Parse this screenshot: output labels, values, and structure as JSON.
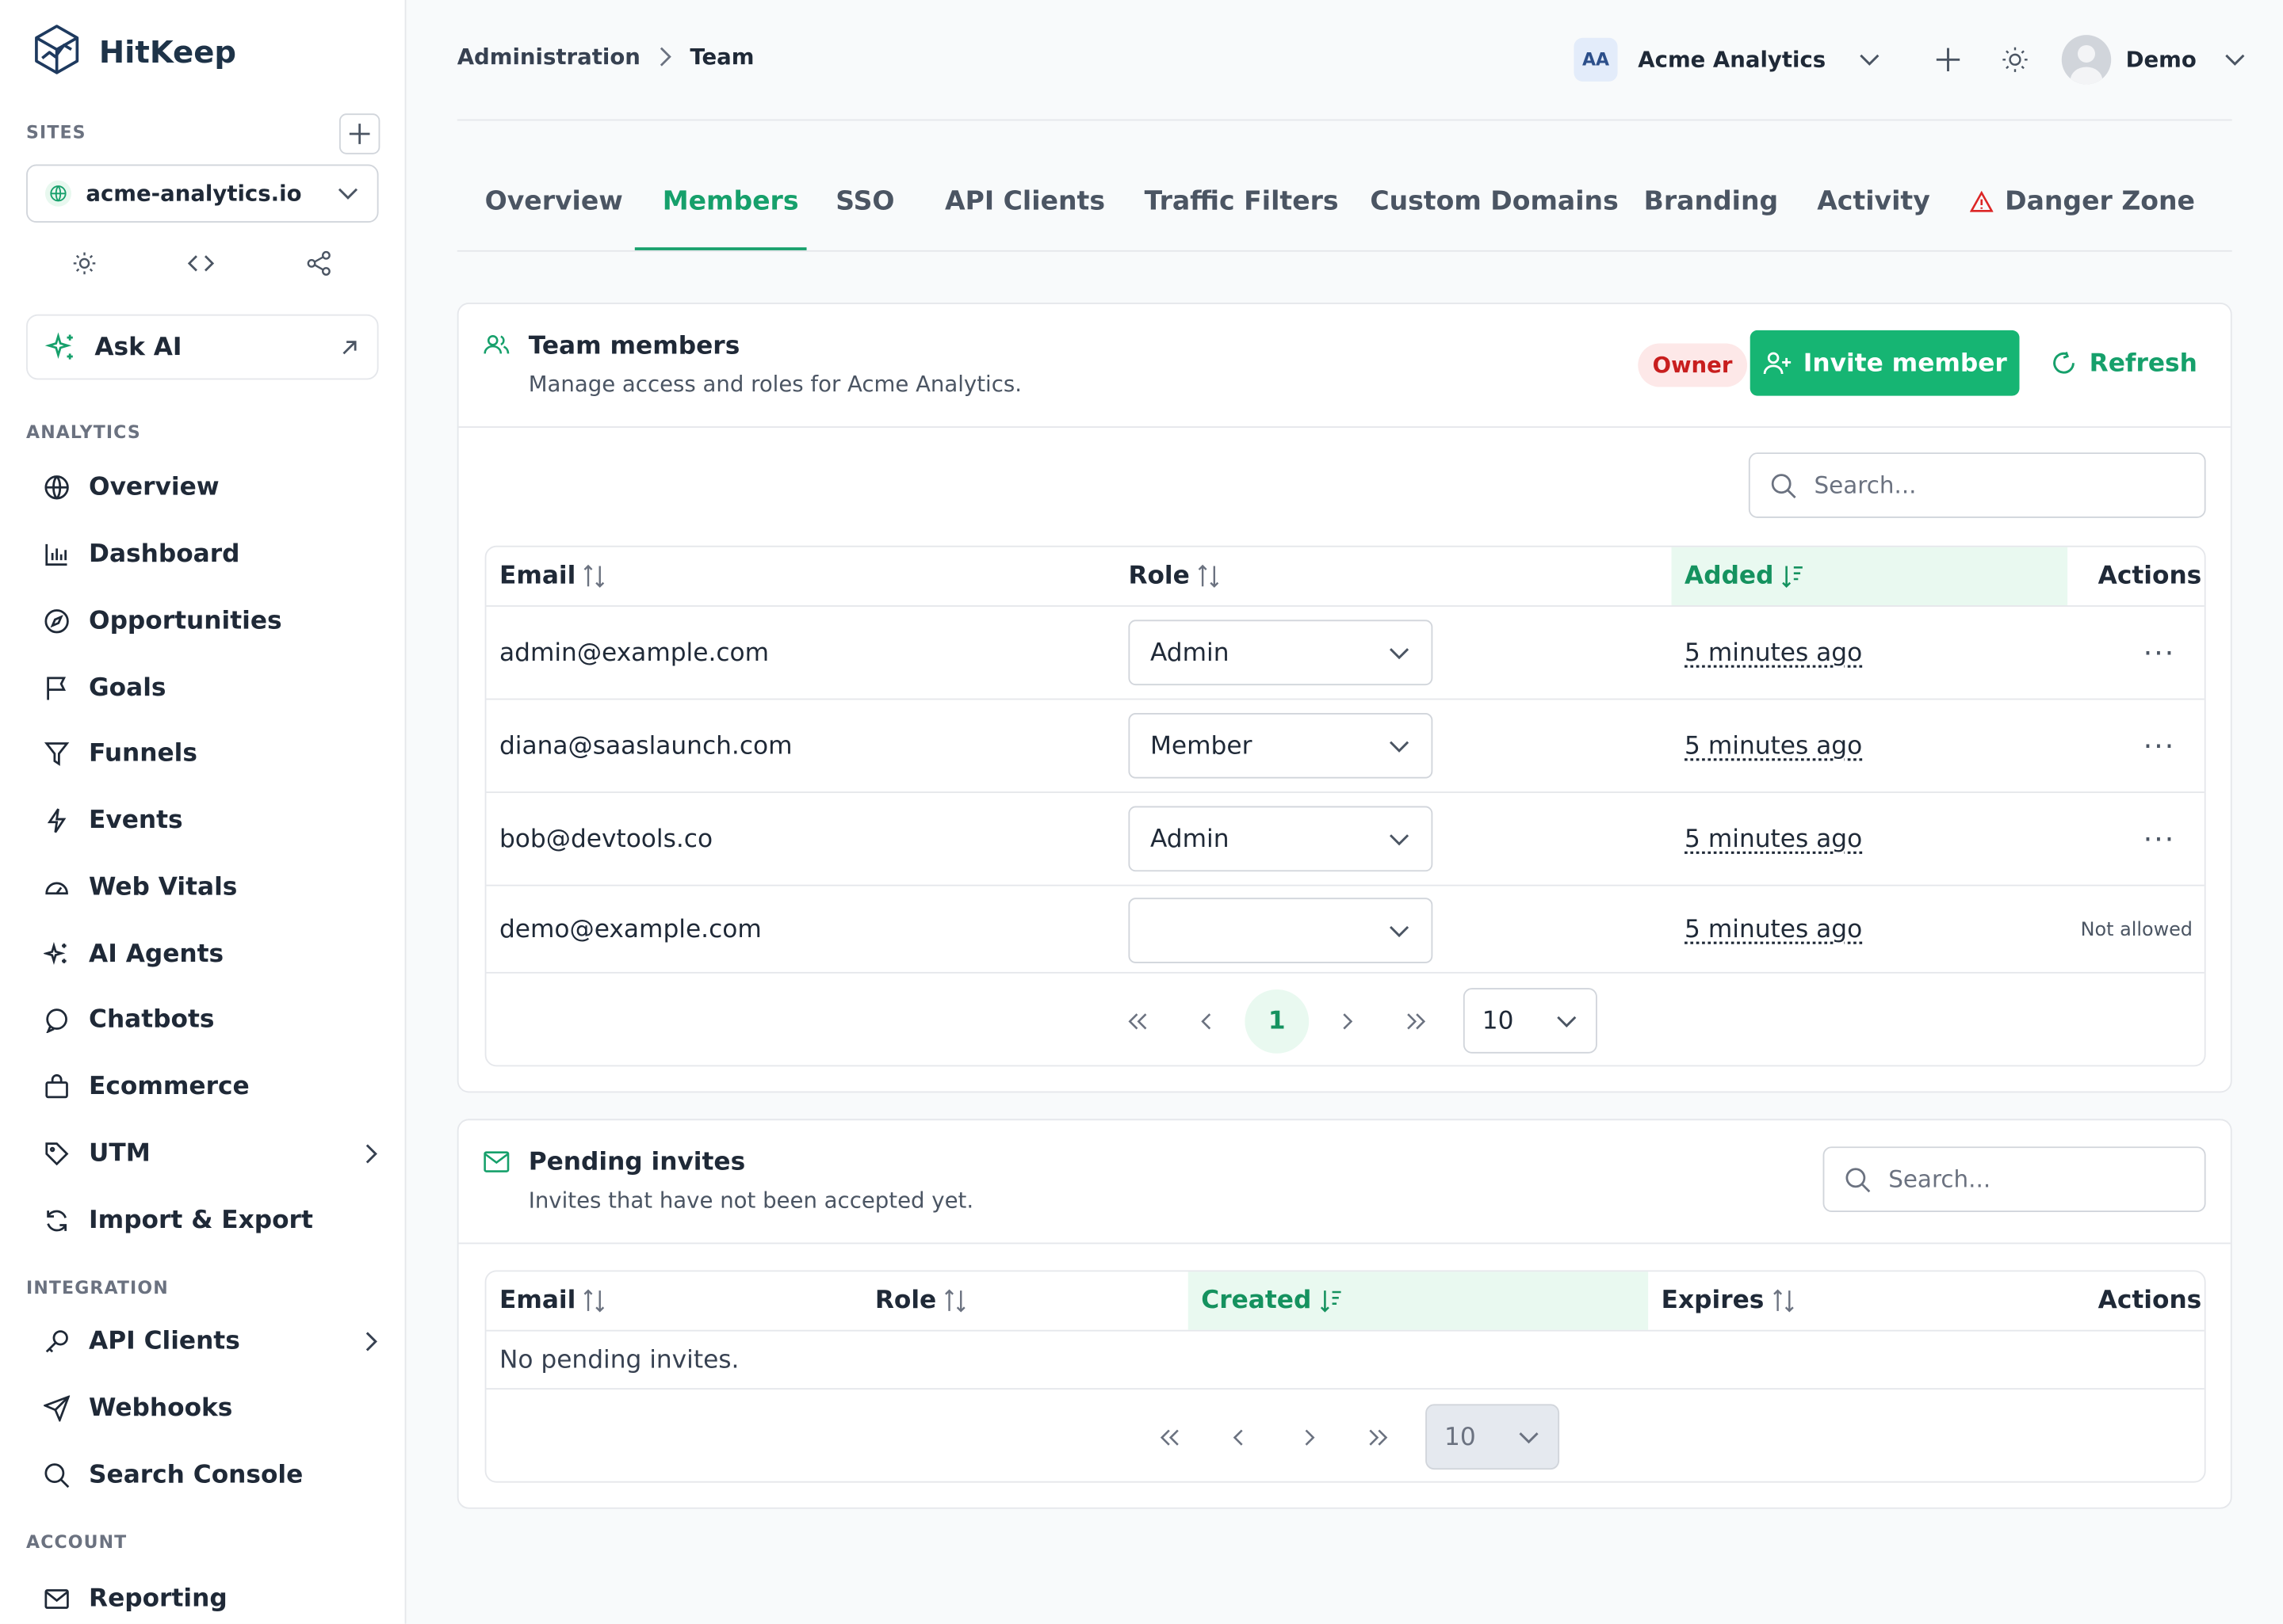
{
  "app": {
    "name": "HitKeep"
  },
  "sidebar": {
    "sites_label": "SITES",
    "site": "acme-analytics.io",
    "ask_ai": "Ask AI",
    "analytics_label": "ANALYTICS",
    "analytics": [
      {
        "label": "Overview",
        "icon": "globe-icon"
      },
      {
        "label": "Dashboard",
        "icon": "bar-chart-icon"
      },
      {
        "label": "Opportunities",
        "icon": "compass-icon"
      },
      {
        "label": "Goals",
        "icon": "flag-icon"
      },
      {
        "label": "Funnels",
        "icon": "funnel-icon"
      },
      {
        "label": "Events",
        "icon": "bolt-icon"
      },
      {
        "label": "Web Vitals",
        "icon": "gauge-icon"
      },
      {
        "label": "AI Agents",
        "icon": "sparkles-icon"
      },
      {
        "label": "Chatbots",
        "icon": "chat-icon"
      },
      {
        "label": "Ecommerce",
        "icon": "shopping-bag-icon"
      },
      {
        "label": "UTM",
        "icon": "tag-icon"
      },
      {
        "label": "Import & Export",
        "icon": "sync-icon"
      }
    ],
    "integration_label": "INTEGRATION",
    "integration": [
      {
        "label": "API Clients",
        "icon": "key-icon"
      },
      {
        "label": "Webhooks",
        "icon": "send-icon"
      },
      {
        "label": "Search Console",
        "icon": "search-icon"
      }
    ],
    "account_label": "ACCOUNT",
    "account": [
      {
        "label": "Reporting",
        "icon": "mail-icon"
      }
    ]
  },
  "header": {
    "breadcrumb": [
      "Administration",
      "Team"
    ],
    "org_initials": "AA",
    "org_name": "Acme Analytics",
    "user_name": "Demo"
  },
  "tabs": [
    "Overview",
    "Members",
    "SSO",
    "API Clients",
    "Traffic Filters",
    "Custom Domains",
    "Branding",
    "Activity",
    "Danger Zone"
  ],
  "active_tab": "Members",
  "members": {
    "title": "Team members",
    "subtitle": "Manage access and roles for Acme Analytics.",
    "role_badge": "Owner",
    "invite_label": "Invite member",
    "refresh_label": "Refresh",
    "search_placeholder": "Search...",
    "columns": {
      "email": "Email",
      "role": "Role",
      "added": "Added",
      "actions": "Actions"
    },
    "rows": [
      {
        "email": "admin@example.com",
        "role": "Admin",
        "added": "5 minutes ago",
        "action": "..."
      },
      {
        "email": "diana@saaslaunch.com",
        "role": "Member",
        "added": "5 minutes ago",
        "action": "..."
      },
      {
        "email": "bob@devtools.co",
        "role": "Admin",
        "added": "5 minutes ago",
        "action": "..."
      },
      {
        "email": "demo@example.com",
        "role": "",
        "added": "5 minutes ago",
        "action": "Not allowed"
      }
    ],
    "page": "1",
    "page_size": "10"
  },
  "invites": {
    "title": "Pending invites",
    "subtitle": "Invites that have not been accepted yet.",
    "search_placeholder": "Search...",
    "columns": {
      "email": "Email",
      "role": "Role",
      "created": "Created",
      "expires": "Expires",
      "actions": "Actions"
    },
    "empty": "No pending invites.",
    "page_size": "10"
  },
  "colors": {
    "accent": "#16b573",
    "accent_text": "#16a06b",
    "danger": "#c81e1e"
  }
}
